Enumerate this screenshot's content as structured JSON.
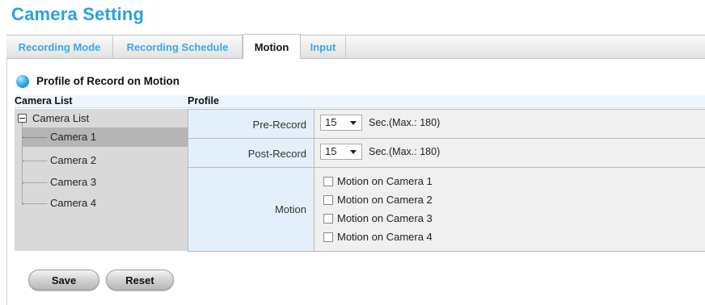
{
  "page": {
    "title": "Camera Setting"
  },
  "tabs": [
    {
      "label": "Recording Mode",
      "active": false
    },
    {
      "label": "Recording Schedule",
      "active": false
    },
    {
      "label": "Motion",
      "active": true
    },
    {
      "label": "Input",
      "active": false
    }
  ],
  "section": {
    "title": "Profile of Record on Motion"
  },
  "columns": {
    "camera_list": "Camera List",
    "profile": "Profile"
  },
  "tree": {
    "root_label": "Camera List",
    "items": [
      {
        "label": "Camera 1",
        "selected": true
      },
      {
        "label": "Camera 2",
        "selected": false
      },
      {
        "label": "Camera 3",
        "selected": false
      },
      {
        "label": "Camera 4",
        "selected": false
      }
    ]
  },
  "profile": {
    "pre_record": {
      "label": "Pre-Record",
      "value": "15",
      "hint": "Sec.(Max.: 180)"
    },
    "post_record": {
      "label": "Post-Record",
      "value": "15",
      "hint": "Sec.(Max.: 180)"
    },
    "motion": {
      "label": "Motion",
      "options": [
        {
          "label": "Motion on Camera 1",
          "checked": false
        },
        {
          "label": "Motion on Camera 2",
          "checked": false
        },
        {
          "label": "Motion on Camera 3",
          "checked": false
        },
        {
          "label": "Motion on Camera 4",
          "checked": false
        }
      ]
    }
  },
  "buttons": {
    "save": "Save",
    "reset": "Reset"
  },
  "colors": {
    "title_blue": "#2aa0e0",
    "tab_blue": "#3aa9e6",
    "label_cell": "#e3f0fb",
    "value_cell": "#f0f0f0",
    "selected_row": "#b5b5b5"
  }
}
